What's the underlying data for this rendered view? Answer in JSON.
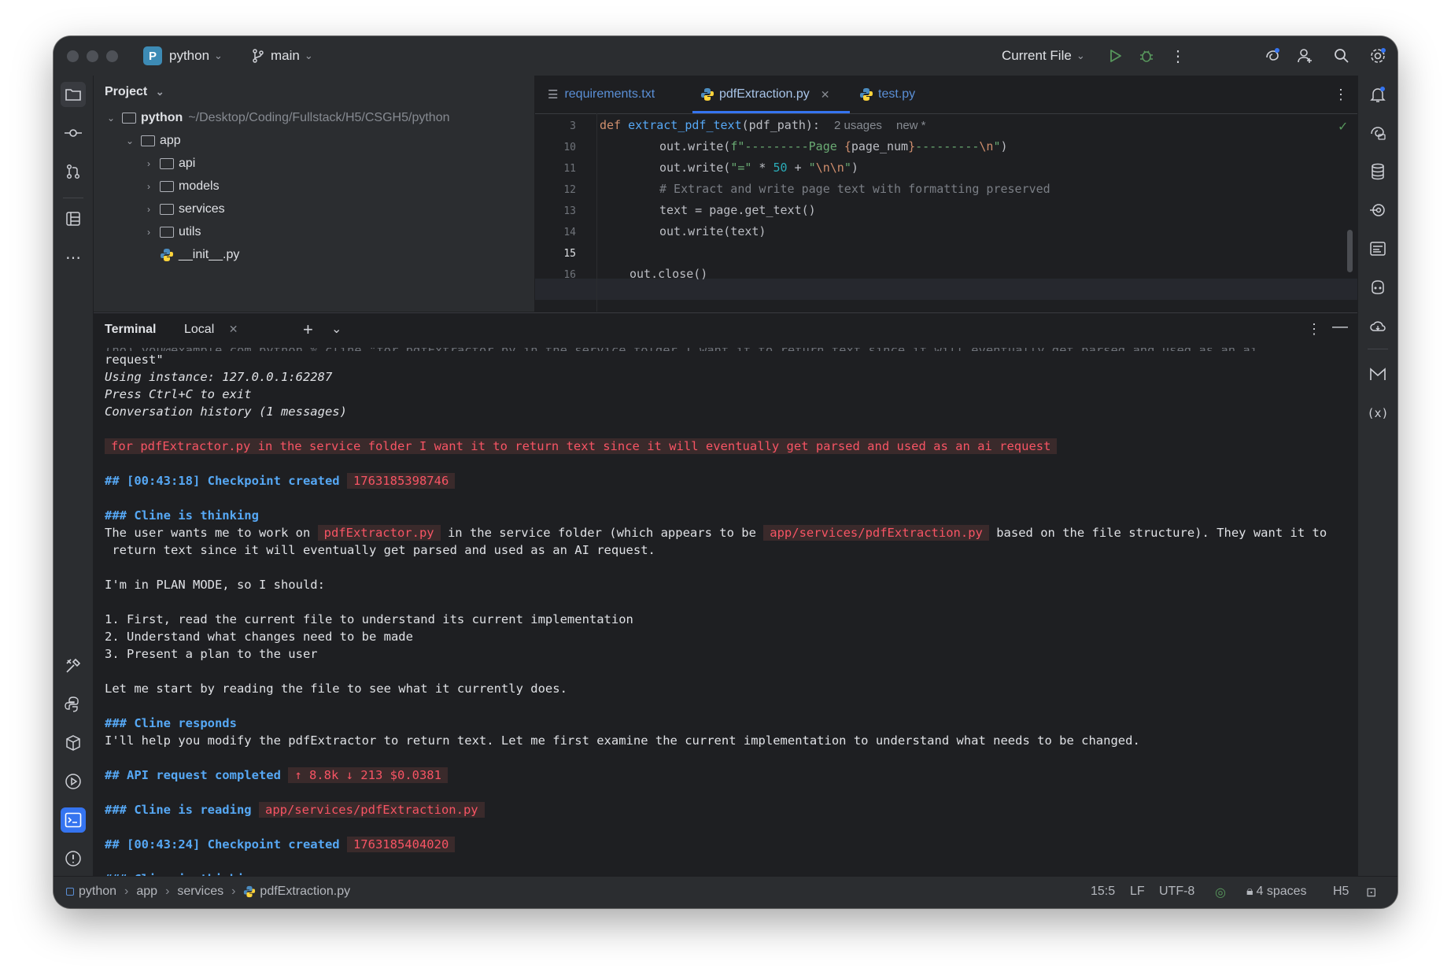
{
  "titlebar": {
    "project_badge": "P",
    "project": "python",
    "branch": "main",
    "run_config": "Current File"
  },
  "project_panel": {
    "title": "Project",
    "root": {
      "name": "python",
      "path": "~/Desktop/Coding/Fullstack/H5/CSGH5/python"
    },
    "items": [
      "app",
      "api",
      "models",
      "services",
      "utils",
      "__init__.py"
    ]
  },
  "editor": {
    "tabs": [
      "requirements.txt",
      "pdfExtraction.py",
      "test.py"
    ],
    "sticky": {
      "line": "3",
      "def": "def",
      "fn": "extract_pdf_text",
      "args": "(pdf_path):",
      "usages": "2 usages",
      "new": "new *"
    },
    "line_numbers": [
      "10",
      "11",
      "12",
      "13",
      "14",
      "15",
      "16"
    ],
    "lines": [
      "out.write(f\"---------Page {page_num}---------\\n\")",
      "out.write(\"=\" * 50 + \"\\n\\n\")",
      "# Extract and write page text with formatting preserved",
      "text = page.get_text()",
      "out.write(text)",
      "",
      "out.close()"
    ]
  },
  "terminal": {
    "title": "Terminal",
    "tab": "Local",
    "lines": {
      "l0": "request\"",
      "l1": "Using instance: 127.0.0.1:62287",
      "l2": "Press Ctrl+C to exit",
      "l3": "Conversation history (1 messages)",
      "user_msg": "for pdfExtractor.py in the service folder I want it to return text since it will eventually get parsed and used as an ai request",
      "cp1_head": "## [00:43:18] Checkpoint created",
      "cp1_id": "1763185398746",
      "think1": "### Cline is thinking",
      "t1a": "The user wants me to work on",
      "t1b": "pdfExtractor.py",
      "t1c": "in the service folder (which appears to be",
      "t1d": "app/services/pdfExtraction.py",
      "t1e": "based on the file structure). They want it to",
      "t1f": " return text since it will eventually get parsed and used as an AI request.",
      "plan": "I'm in PLAN MODE, so I should:",
      "s1": "1. First, read the current file to understand its current implementation",
      "s2": "2. Understand what changes need to be made",
      "s3": "3. Present a plan to the user",
      "start": "Let me start by reading the file to see what it currently does.",
      "responds": "### Cline responds",
      "resp": "I'll help you modify the pdfExtractor to return text. Let me first examine the current implementation to understand what needs to be changed.",
      "api_head": "## API request completed",
      "api_val": "↑ 8.8k ↓ 213 $0.0381",
      "read_head": "### Cline is reading",
      "read_val": "app/services/pdfExtraction.py",
      "cp2_head": "## [00:43:24] Checkpoint created",
      "cp2_id": "1763185404020",
      "think2": "### Cline is thinking"
    }
  },
  "statusbar": {
    "crumbs": [
      "python",
      "app",
      "services",
      "pdfExtraction.py"
    ],
    "position": "15:5",
    "line_sep": "LF",
    "encoding": "UTF-8",
    "indent": "4 spaces",
    "extra": "H5"
  },
  "colors": {
    "accent": "#3574f0",
    "bg": "#1e1f22",
    "panel": "#2b2d30",
    "error_text": "#f75464"
  }
}
